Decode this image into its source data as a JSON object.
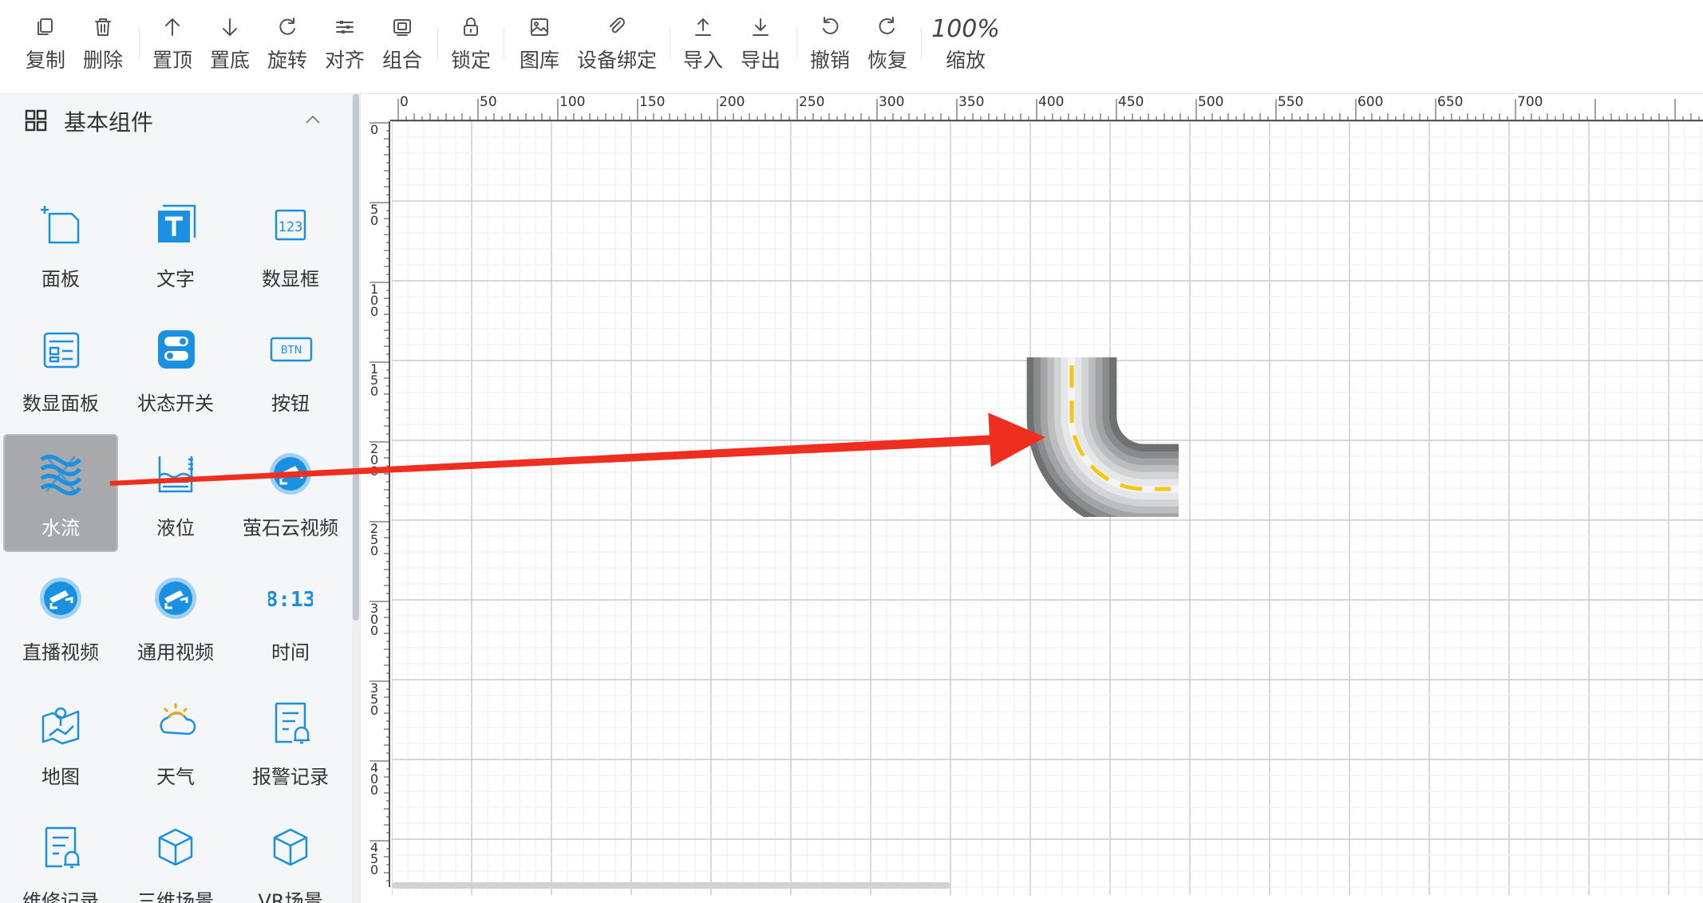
{
  "toolbar": {
    "items": [
      {
        "label": "复制",
        "icon": "copy-icon"
      },
      {
        "label": "删除",
        "icon": "trash-icon"
      },
      {
        "label": "置顶",
        "icon": "arrow-up-icon"
      },
      {
        "label": "置底",
        "icon": "arrow-down-icon"
      },
      {
        "label": "旋转",
        "icon": "rotate-icon"
      },
      {
        "label": "对齐",
        "icon": "align-icon"
      },
      {
        "label": "组合",
        "icon": "group-icon"
      },
      {
        "label": "锁定",
        "icon": "lock-icon"
      },
      {
        "label": "图库",
        "icon": "gallery-icon"
      },
      {
        "label": "设备绑定",
        "icon": "link-icon"
      },
      {
        "label": "导入",
        "icon": "import-icon"
      },
      {
        "label": "导出",
        "icon": "export-icon"
      },
      {
        "label": "撤销",
        "icon": "undo-icon"
      },
      {
        "label": "恢复",
        "icon": "redo-icon"
      },
      {
        "label": "缩放",
        "icon": "zoom-text",
        "value": "100%"
      }
    ]
  },
  "sidebar": {
    "section_title": "基本组件",
    "components": [
      {
        "label": "面板",
        "icon": "panel-icon"
      },
      {
        "label": "文字",
        "icon": "text-icon"
      },
      {
        "label": "数显框",
        "icon": "digital-display-icon"
      },
      {
        "label": "数显面板",
        "icon": "digital-panel-icon"
      },
      {
        "label": "状态开关",
        "icon": "status-switch-icon"
      },
      {
        "label": "按钮",
        "icon": "button-icon",
        "icon_text": "BTN"
      },
      {
        "label": "水流",
        "icon": "water-flow-icon",
        "active": true
      },
      {
        "label": "液位",
        "icon": "liquid-level-icon"
      },
      {
        "label": "萤石云视频",
        "icon": "camera-icon"
      },
      {
        "label": "直播视频",
        "icon": "camera-icon"
      },
      {
        "label": "通用视频",
        "icon": "camera-icon"
      },
      {
        "label": "时间",
        "icon": "time-icon",
        "icon_text": "8:13"
      },
      {
        "label": "地图",
        "icon": "map-icon"
      },
      {
        "label": "天气",
        "icon": "weather-icon"
      },
      {
        "label": "报警记录",
        "icon": "alarm-record-icon"
      },
      {
        "label": "维修记录",
        "icon": "repair-record-icon"
      },
      {
        "label": "三维场景",
        "icon": "cube-icon"
      },
      {
        "label": "VR场景",
        "icon": "vr-cube-icon"
      }
    ]
  },
  "rulers": {
    "top_labels": [
      "0",
      "50",
      "100",
      "150",
      "200",
      "250",
      "300",
      "350",
      "400",
      "450",
      "500",
      "550",
      "600",
      "650",
      "700"
    ],
    "left_labels": [
      "0",
      "50",
      "100",
      "150",
      "200",
      "250",
      "300",
      "350",
      "400",
      "450"
    ]
  },
  "colors": {
    "accent_blue": "#1b8fe0",
    "arrow_red": "#ee2e1f",
    "flow_yellow": "#f5c518",
    "active_bg": "#a8a9ab"
  }
}
